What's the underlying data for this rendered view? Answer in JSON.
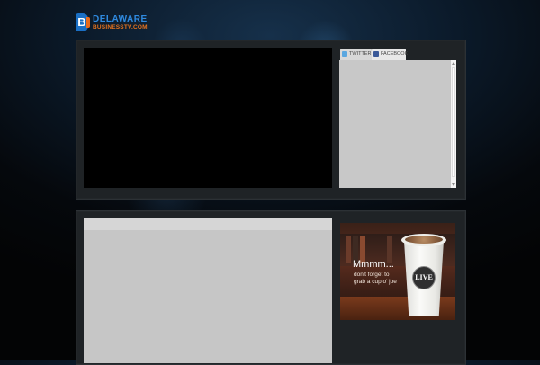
{
  "logo": {
    "line1": "DELAWARE",
    "line2": "BUSINESSTV.COM",
    "mark": "B"
  },
  "colors": {
    "brand_blue": "#1a6fc4",
    "brand_orange": "#e86a1a",
    "panel": "#1f2326",
    "widget_bg": "#c8c8c8"
  },
  "social": {
    "tabs": [
      {
        "label": "TWITTER",
        "icon": "twitter-icon"
      },
      {
        "label": "FACEBOOK",
        "icon": "facebook-icon"
      }
    ]
  },
  "ad": {
    "headline": "Mmmm...",
    "sub": "don't forget to grab a cup o' joe",
    "cup_badge": "LIVE"
  }
}
